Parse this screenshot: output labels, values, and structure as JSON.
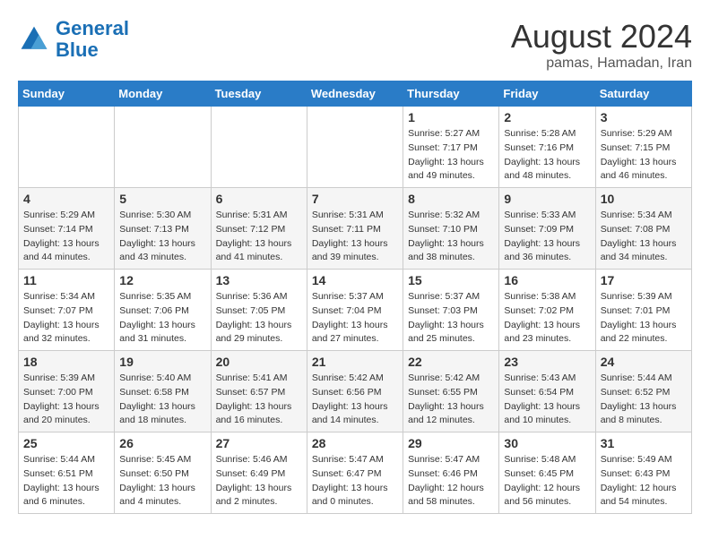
{
  "header": {
    "logo_line1": "General",
    "logo_line2": "Blue",
    "title": "August 2024",
    "subtitle": "pamas, Hamadan, Iran"
  },
  "weekdays": [
    "Sunday",
    "Monday",
    "Tuesday",
    "Wednesday",
    "Thursday",
    "Friday",
    "Saturday"
  ],
  "weeks": [
    [
      {
        "day": "",
        "info": ""
      },
      {
        "day": "",
        "info": ""
      },
      {
        "day": "",
        "info": ""
      },
      {
        "day": "",
        "info": ""
      },
      {
        "day": "1",
        "info": "Sunrise: 5:27 AM\nSunset: 7:17 PM\nDaylight: 13 hours\nand 49 minutes."
      },
      {
        "day": "2",
        "info": "Sunrise: 5:28 AM\nSunset: 7:16 PM\nDaylight: 13 hours\nand 48 minutes."
      },
      {
        "day": "3",
        "info": "Sunrise: 5:29 AM\nSunset: 7:15 PM\nDaylight: 13 hours\nand 46 minutes."
      }
    ],
    [
      {
        "day": "4",
        "info": "Sunrise: 5:29 AM\nSunset: 7:14 PM\nDaylight: 13 hours\nand 44 minutes."
      },
      {
        "day": "5",
        "info": "Sunrise: 5:30 AM\nSunset: 7:13 PM\nDaylight: 13 hours\nand 43 minutes."
      },
      {
        "day": "6",
        "info": "Sunrise: 5:31 AM\nSunset: 7:12 PM\nDaylight: 13 hours\nand 41 minutes."
      },
      {
        "day": "7",
        "info": "Sunrise: 5:31 AM\nSunset: 7:11 PM\nDaylight: 13 hours\nand 39 minutes."
      },
      {
        "day": "8",
        "info": "Sunrise: 5:32 AM\nSunset: 7:10 PM\nDaylight: 13 hours\nand 38 minutes."
      },
      {
        "day": "9",
        "info": "Sunrise: 5:33 AM\nSunset: 7:09 PM\nDaylight: 13 hours\nand 36 minutes."
      },
      {
        "day": "10",
        "info": "Sunrise: 5:34 AM\nSunset: 7:08 PM\nDaylight: 13 hours\nand 34 minutes."
      }
    ],
    [
      {
        "day": "11",
        "info": "Sunrise: 5:34 AM\nSunset: 7:07 PM\nDaylight: 13 hours\nand 32 minutes."
      },
      {
        "day": "12",
        "info": "Sunrise: 5:35 AM\nSunset: 7:06 PM\nDaylight: 13 hours\nand 31 minutes."
      },
      {
        "day": "13",
        "info": "Sunrise: 5:36 AM\nSunset: 7:05 PM\nDaylight: 13 hours\nand 29 minutes."
      },
      {
        "day": "14",
        "info": "Sunrise: 5:37 AM\nSunset: 7:04 PM\nDaylight: 13 hours\nand 27 minutes."
      },
      {
        "day": "15",
        "info": "Sunrise: 5:37 AM\nSunset: 7:03 PM\nDaylight: 13 hours\nand 25 minutes."
      },
      {
        "day": "16",
        "info": "Sunrise: 5:38 AM\nSunset: 7:02 PM\nDaylight: 13 hours\nand 23 minutes."
      },
      {
        "day": "17",
        "info": "Sunrise: 5:39 AM\nSunset: 7:01 PM\nDaylight: 13 hours\nand 22 minutes."
      }
    ],
    [
      {
        "day": "18",
        "info": "Sunrise: 5:39 AM\nSunset: 7:00 PM\nDaylight: 13 hours\nand 20 minutes."
      },
      {
        "day": "19",
        "info": "Sunrise: 5:40 AM\nSunset: 6:58 PM\nDaylight: 13 hours\nand 18 minutes."
      },
      {
        "day": "20",
        "info": "Sunrise: 5:41 AM\nSunset: 6:57 PM\nDaylight: 13 hours\nand 16 minutes."
      },
      {
        "day": "21",
        "info": "Sunrise: 5:42 AM\nSunset: 6:56 PM\nDaylight: 13 hours\nand 14 minutes."
      },
      {
        "day": "22",
        "info": "Sunrise: 5:42 AM\nSunset: 6:55 PM\nDaylight: 13 hours\nand 12 minutes."
      },
      {
        "day": "23",
        "info": "Sunrise: 5:43 AM\nSunset: 6:54 PM\nDaylight: 13 hours\nand 10 minutes."
      },
      {
        "day": "24",
        "info": "Sunrise: 5:44 AM\nSunset: 6:52 PM\nDaylight: 13 hours\nand 8 minutes."
      }
    ],
    [
      {
        "day": "25",
        "info": "Sunrise: 5:44 AM\nSunset: 6:51 PM\nDaylight: 13 hours\nand 6 minutes."
      },
      {
        "day": "26",
        "info": "Sunrise: 5:45 AM\nSunset: 6:50 PM\nDaylight: 13 hours\nand 4 minutes."
      },
      {
        "day": "27",
        "info": "Sunrise: 5:46 AM\nSunset: 6:49 PM\nDaylight: 13 hours\nand 2 minutes."
      },
      {
        "day": "28",
        "info": "Sunrise: 5:47 AM\nSunset: 6:47 PM\nDaylight: 13 hours\nand 0 minutes."
      },
      {
        "day": "29",
        "info": "Sunrise: 5:47 AM\nSunset: 6:46 PM\nDaylight: 12 hours\nand 58 minutes."
      },
      {
        "day": "30",
        "info": "Sunrise: 5:48 AM\nSunset: 6:45 PM\nDaylight: 12 hours\nand 56 minutes."
      },
      {
        "day": "31",
        "info": "Sunrise: 5:49 AM\nSunset: 6:43 PM\nDaylight: 12 hours\nand 54 minutes."
      }
    ]
  ]
}
